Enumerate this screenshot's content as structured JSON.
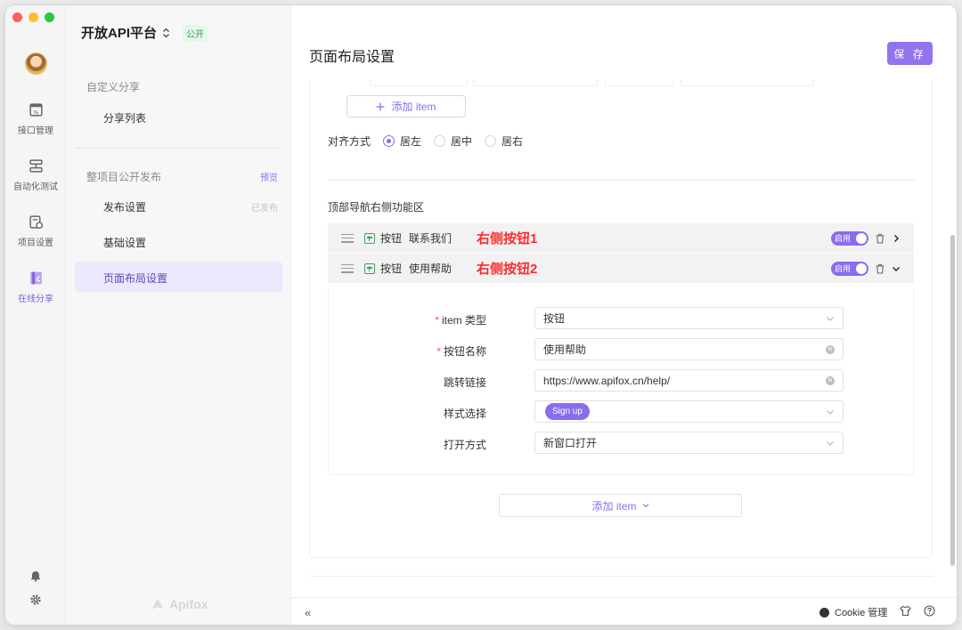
{
  "window": {
    "traffic_colors": [
      "#ff5f57",
      "#febc2e",
      "#28c840"
    ]
  },
  "rail": {
    "items": [
      {
        "label": "接口管理",
        "icon": "api-doc-icon"
      },
      {
        "label": "自动化测试",
        "icon": "automation-icon"
      },
      {
        "label": "项目设置",
        "icon": "project-settings-icon"
      },
      {
        "label": "在线分享",
        "icon": "online-share-icon"
      }
    ]
  },
  "sidebar": {
    "project_name": "开放API平台",
    "project_badge": "公开",
    "group1_title": "自定义分享",
    "group1_items": [
      "分享列表"
    ],
    "group2_title": "整项目公开发布",
    "group2_tag": "预览",
    "group2_items": [
      {
        "label": "发布设置",
        "tag": "已发布"
      },
      {
        "label": "基础设置",
        "tag": ""
      },
      {
        "label": "页面布局设置",
        "tag": ""
      }
    ],
    "brand": "Apifox"
  },
  "main": {
    "title": "页面布局设置",
    "save_label": "保 存",
    "add_item_label": "添加 item",
    "align_label": "对齐方式",
    "align_options": [
      "居左",
      "居中",
      "居右"
    ],
    "align_selected": "居左",
    "section_label": "顶部导航右侧功能区",
    "nav_items": [
      {
        "type": "按钮",
        "name": "联系我们",
        "note": "右侧按钮1",
        "toggle": "启用"
      },
      {
        "type": "按钮",
        "name": "使用帮助",
        "note": "右侧按钮2",
        "toggle": "启用"
      }
    ],
    "form": {
      "item_type_label": "item 类型",
      "item_type_value": "按钮",
      "button_name_label": "按钮名称",
      "button_name_value": "使用帮助",
      "link_label": "跳转链接",
      "link_value": "https://www.apifox.cn/help/",
      "style_label": "样式选择",
      "style_value": "Sign up",
      "open_label": "打开方式",
      "open_value": "新窗口打开"
    },
    "add_item_bottom_label": "添加 item"
  },
  "footer": {
    "cookie_label": "Cookie 管理"
  },
  "colors": {
    "accent": "#9373ee",
    "red_note": "#ff2a2a",
    "public_badge": "#2e9e55"
  }
}
